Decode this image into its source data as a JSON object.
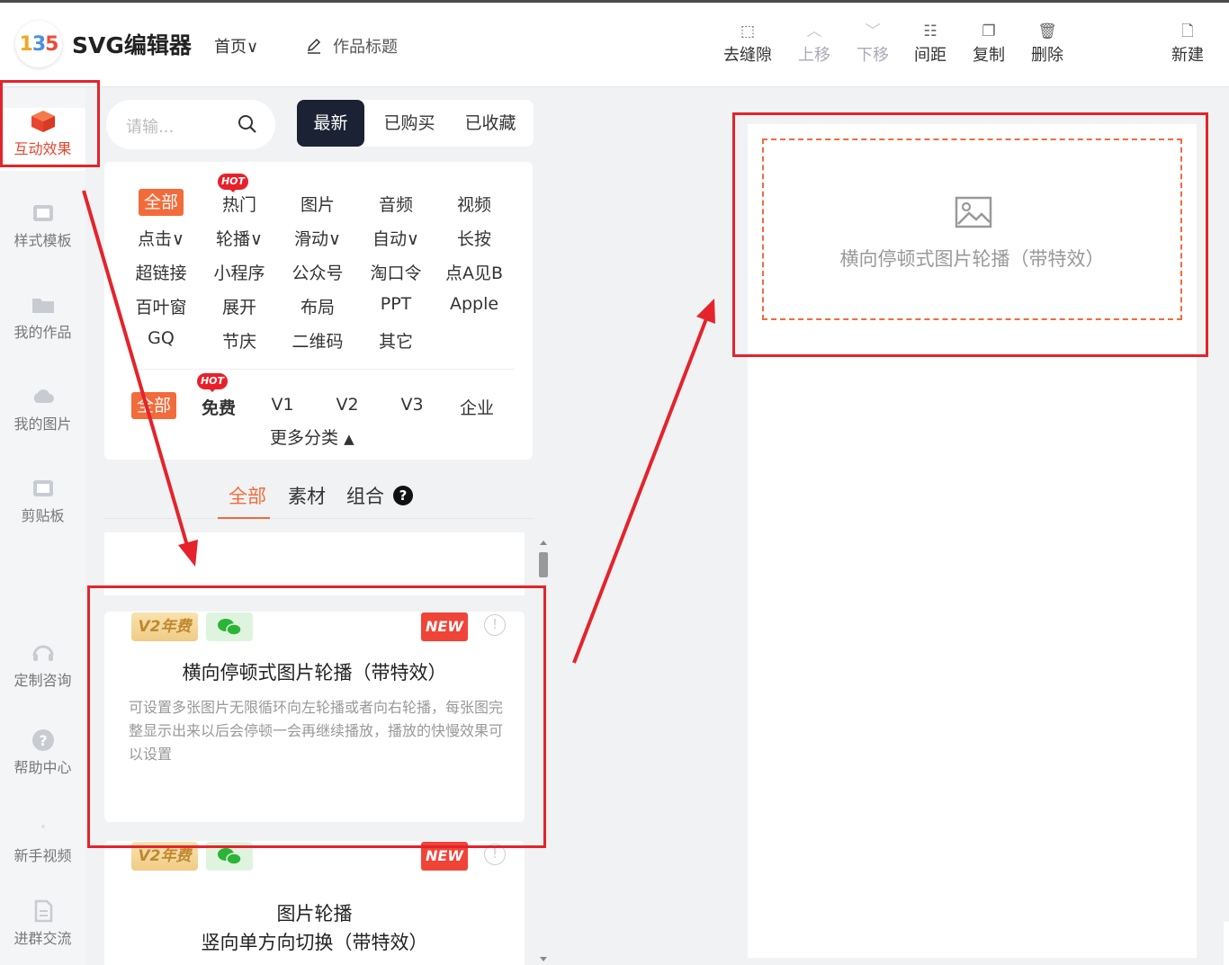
{
  "header": {
    "app_title": "SVG编辑器",
    "home_label": "首页",
    "work_title": "作品标题",
    "tools": [
      {
        "label": "去缝隙",
        "icon": "gap-icon",
        "enabled": true
      },
      {
        "label": "上移",
        "icon": "chevron-up-icon",
        "enabled": false
      },
      {
        "label": "下移",
        "icon": "chevron-down-icon",
        "enabled": false
      },
      {
        "label": "间距",
        "icon": "spacing-icon",
        "enabled": true
      },
      {
        "label": "复制",
        "icon": "copy-icon",
        "enabled": true
      },
      {
        "label": "删除",
        "icon": "trash-icon",
        "enabled": true
      },
      {
        "label": "新建",
        "icon": "new-file-icon",
        "enabled": true
      }
    ]
  },
  "rail": {
    "items": [
      {
        "label": "互动效果",
        "icon": "cube-icon",
        "active": true
      },
      {
        "label": "样式模板",
        "icon": "template-icon"
      },
      {
        "label": "我的作品",
        "icon": "folder-icon"
      },
      {
        "label": "我的图片",
        "icon": "cloud-icon"
      },
      {
        "label": "剪贴板",
        "icon": "clipboard-icon"
      },
      {
        "label": "定制咨询",
        "icon": "headset-icon"
      },
      {
        "label": "帮助中心",
        "icon": "help-icon"
      },
      {
        "label": "新手视频",
        "icon": "video-icon"
      },
      {
        "label": "进群交流",
        "icon": "group-icon"
      }
    ]
  },
  "search": {
    "placeholder": "请输..."
  },
  "top_tabs": [
    "最新",
    "已购买",
    "已收藏"
  ],
  "categories": {
    "row1": [
      "全部",
      "热门",
      "图片",
      "音频",
      "视频"
    ],
    "row2": [
      "点击∨",
      "轮播∨",
      "滑动∨",
      "自动∨",
      "长按"
    ],
    "row3": [
      "超链接",
      "小程序",
      "公众号",
      "淘口令",
      "点A见B"
    ],
    "row4": [
      "百叶窗",
      "展开",
      "布局",
      "PPT",
      "Apple"
    ],
    "row5": [
      "GQ",
      "节庆",
      "二维码",
      "其它"
    ],
    "hot_label": "HOT"
  },
  "versions": {
    "items": [
      "全部",
      "免费",
      "V1",
      "V2",
      "V3",
      "企业"
    ],
    "more_label": "更多分类"
  },
  "sub_tabs": [
    "全部",
    "素材",
    "组合"
  ],
  "cards": [
    {
      "badge_version": "V2年费",
      "badge_new": "NEW",
      "title": "横向停顿式图片轮播（带特效）",
      "desc": "可设置多张图片无限循环向左轮播或者向右轮播，每张图完整显示出来以后会停顿一会再继续播放，播放的快慢效果可以设置"
    },
    {
      "badge_version": "V2年费",
      "badge_new": "NEW",
      "title_line1": "图片轮播",
      "title_line2": "竖向单方向切换（带特效）"
    }
  ],
  "canvas": {
    "placeholder_text": "横向停顿式图片轮播（带特效）"
  },
  "colors": {
    "accent": "#f26b3a",
    "annotation": "#e5232a",
    "dark_tab": "#1a2233"
  }
}
